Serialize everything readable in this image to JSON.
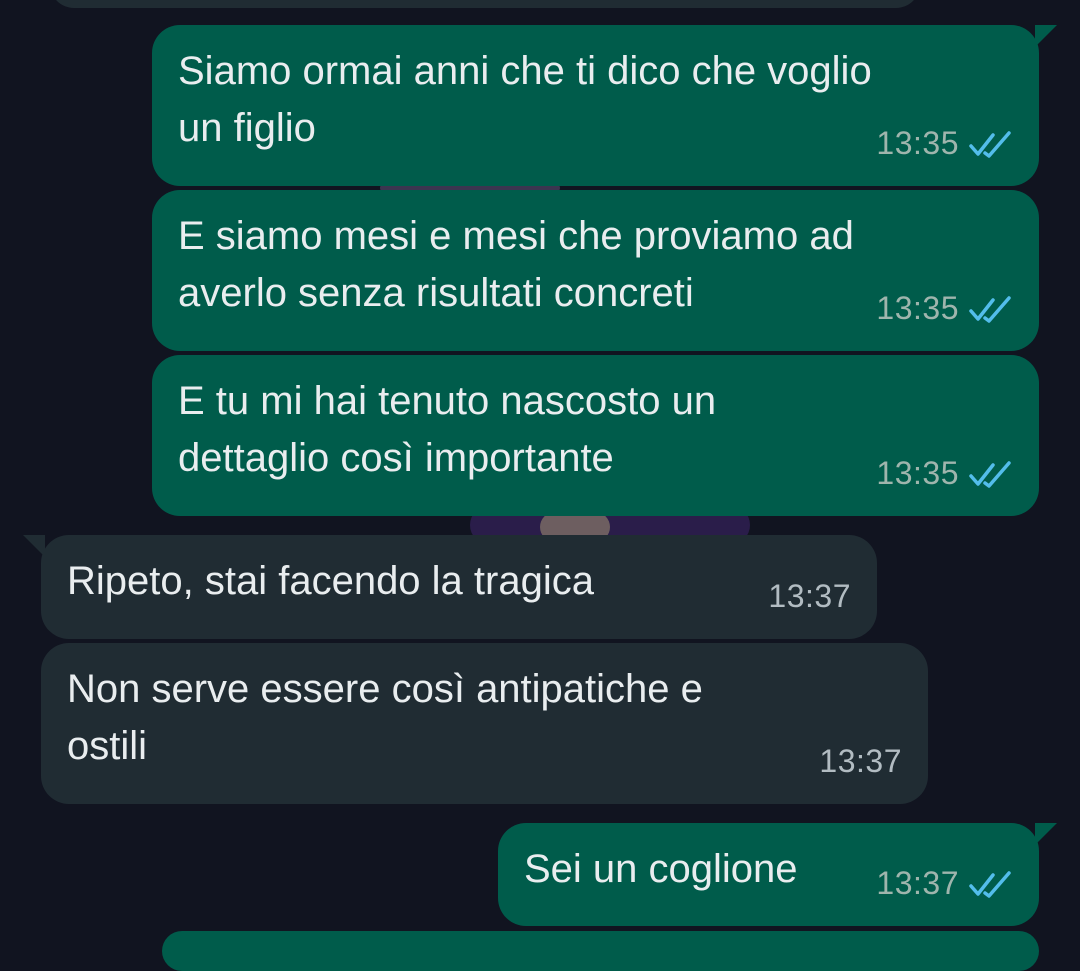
{
  "colors": {
    "background": "#111420",
    "outgoing_bubble": "#005c4b",
    "incoming_bubble": "#202c33",
    "text": "#e9edef",
    "read_ticks": "#53bdeb"
  },
  "messages": [
    {
      "direction": "outgoing",
      "text": "Siamo ormai anni che ti dico che voglio\nun figlio",
      "time": "13:35",
      "status_icon": "double-check-read-icon"
    },
    {
      "direction": "outgoing",
      "text": "E siamo mesi e mesi che proviamo ad\naverlo senza risultati concreti",
      "time": "13:35",
      "status_icon": "double-check-read-icon"
    },
    {
      "direction": "outgoing",
      "text": "E tu mi hai tenuto nascosto un\ndettaglio così importante",
      "time": "13:35",
      "status_icon": "double-check-read-icon"
    },
    {
      "direction": "incoming",
      "text": "Ripeto, stai facendo la tragica",
      "time": "13:37"
    },
    {
      "direction": "incoming",
      "text": "Non serve essere così antipatiche e\nostili",
      "time": "13:37"
    },
    {
      "direction": "outgoing",
      "text": "Sei un coglione",
      "time": "13:37",
      "status_icon": "double-check-read-icon"
    }
  ]
}
